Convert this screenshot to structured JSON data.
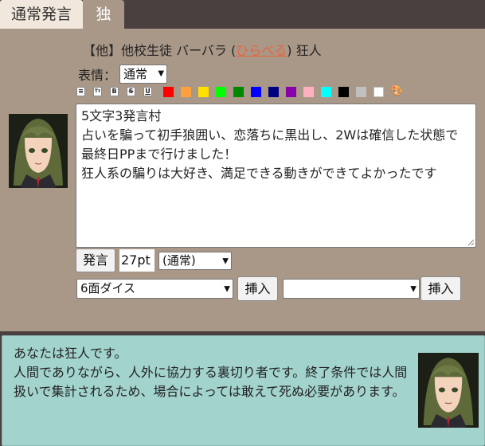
{
  "tabs": [
    {
      "label": "通常発言",
      "active": true
    },
    {
      "label": "独",
      "active": false
    }
  ],
  "speaker": {
    "prefix": "【他】他校生徒 バーバラ (",
    "player": "ひらべる",
    "suffix": ") 狂人"
  },
  "expression": {
    "label": "表情：",
    "value": "通常"
  },
  "toolbar": {
    "tools": [
      {
        "icon": "align-left-icon",
        "glyph": "≡"
      },
      {
        "icon": "font-size-icon",
        "glyph": "Tт"
      },
      {
        "icon": "bold-icon",
        "glyph": "B"
      },
      {
        "icon": "strikethrough-icon",
        "glyph": "S"
      },
      {
        "icon": "underline-icon",
        "glyph": "U"
      }
    ],
    "colors": [
      "#ff0000",
      "#ffa040",
      "#ffe000",
      "#00ff00",
      "#008800",
      "#0000ff",
      "#000080",
      "#8800aa",
      "#ffb0c0",
      "#00ffff",
      "#000000",
      "#c0c0c0",
      "#ffffff"
    ],
    "palette_icon": "palette-icon"
  },
  "message": "5文字3発言村\n占いを騙って初手狼囲い、恋落ちに黒出し、2Wは確信した状態で最終日PPまで行けました！\n狂人系の騙りは大好き、満足できる動きができてよかったです",
  "controls": {
    "say_label": "発言",
    "pt_value": "27pt",
    "mode_value": "(通常)",
    "dice_value": "6面ダイス",
    "insert_label": "挿入",
    "second_select_value": "",
    "insert2_label": "挿入"
  },
  "role": {
    "text": "あなたは狂人です。\n人間でありながら、人外に協力する裏切り者です。終了条件では人間扱いで集計されるため、場合によっては敢えて死ぬ必要があります。"
  }
}
